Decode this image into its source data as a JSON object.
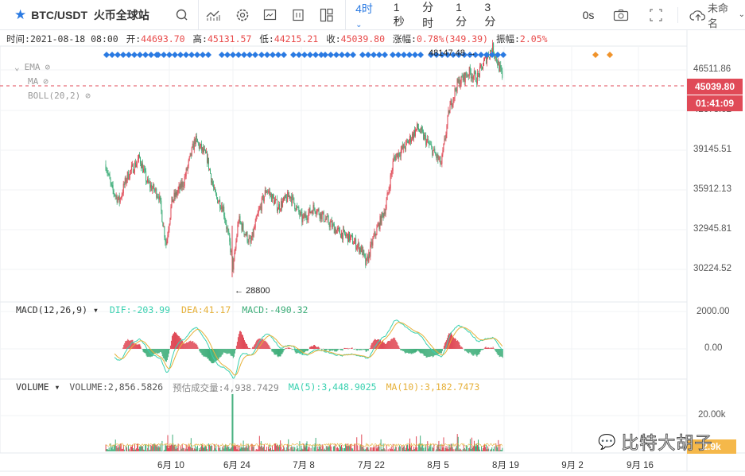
{
  "toolbar": {
    "symbol": "BTC/USDT",
    "exchange": "火币全球站",
    "intervals": [
      {
        "label": "4时",
        "active": true
      },
      {
        "label": "1秒"
      },
      {
        "label": "分时"
      },
      {
        "label": "1分"
      },
      {
        "label": "3分"
      }
    ],
    "countdown": "0s",
    "layout_name": "未命名",
    "icons": [
      "star-icon",
      "search-icon",
      "indicator-icon",
      "gear-icon",
      "chart-template-icon",
      "compare-icon",
      "layout-icon",
      "camera-icon",
      "fullscreen-icon",
      "cloud-upload-icon"
    ]
  },
  "info": {
    "time_label": "时间:",
    "time": "2021-08-18 08:00",
    "open_label": "开:",
    "open": "44693.70",
    "high_label": "高:",
    "high": "45131.57",
    "low_label": "低:",
    "low": "44215.21",
    "close_label": "收:",
    "close": "45039.80",
    "change_label": "涨幅:",
    "change": "0.78%(349.39)",
    "amp_label": "振幅:",
    "amp": "2.05%"
  },
  "overlays": [
    "EMA",
    "MA",
    "BOLL(20,2)"
  ],
  "price_axis": [
    "46511.86",
    "42678.02",
    "39145.51",
    "35912.13",
    "32945.81",
    "30224.52"
  ],
  "current_price": "45039.80",
  "countdown_tag": "01:41:09",
  "max_label": "48147.48",
  "min_label": "28800",
  "macd": {
    "title": "MACD(12,26,9)",
    "dif": "DIF:-203.99",
    "dea": "DEA:41.17",
    "macd": "MACD:-490.32",
    "axis": [
      "2000.00",
      "0.00"
    ]
  },
  "volume": {
    "title": "VOLUME",
    "vol": "VOLUME:2,856.5826",
    "est_label": "预估成交量:",
    "est": "4,938.7429",
    "ma5": "MA(5):3,448.9025",
    "ma10": "MA(10):3,182.7473",
    "axis": "20.00k",
    "tag": "2.9k"
  },
  "time_axis": [
    "6月 10",
    "6月 24",
    "7月 8",
    "7月 22",
    "8月 5",
    "8月 19",
    "9月 2",
    "9月 16"
  ],
  "watermark": "比特大胡子",
  "colors": {
    "up": "#e04a57",
    "down": "#3fae7a",
    "accent": "#2a7ae2",
    "dif": "#3ad1b0",
    "dea": "#e6b13a"
  },
  "chart_data": {
    "type": "candlestick",
    "interval": "4h",
    "start_date": "2021-05-28",
    "note": "key closes, [day offset, price]",
    "key_points": [
      [
        0,
        38000
      ],
      [
        1.2,
        36000
      ],
      [
        2.8,
        35000
      ],
      [
        4.4,
        37000
      ],
      [
        7,
        38500
      ],
      [
        8.6,
        36500
      ],
      [
        11,
        35500
      ],
      [
        12.5,
        31500
      ],
      [
        13.7,
        35000
      ],
      [
        16.1,
        36500
      ],
      [
        18.5,
        40000
      ],
      [
        21,
        38500
      ],
      [
        22.6,
        35500
      ],
      [
        24.3,
        34500
      ],
      [
        25.9,
        31000
      ],
      [
        26.4,
        29500
      ],
      [
        27.5,
        33500
      ],
      [
        30,
        31500
      ],
      [
        31.6,
        34000
      ],
      [
        33.3,
        36000
      ],
      [
        35.7,
        34500
      ],
      [
        38.2,
        35500
      ],
      [
        40.7,
        33500
      ],
      [
        43.2,
        34500
      ],
      [
        45.6,
        33500
      ],
      [
        48.1,
        32500
      ],
      [
        50.6,
        32000
      ],
      [
        53.1,
        31000
      ],
      [
        53.9,
        29800
      ],
      [
        55.5,
        32000
      ],
      [
        58,
        34500
      ],
      [
        59.7,
        38500
      ],
      [
        62.1,
        39500
      ],
      [
        64.6,
        41000
      ],
      [
        67.1,
        39500
      ],
      [
        69.5,
        38000
      ],
      [
        71.2,
        42500
      ],
      [
        72.8,
        44500
      ],
      [
        75.3,
        45500
      ],
      [
        76.9,
        45000
      ],
      [
        78.6,
        46500
      ],
      [
        80.2,
        47500
      ],
      [
        82.2,
        45040
      ]
    ]
  }
}
